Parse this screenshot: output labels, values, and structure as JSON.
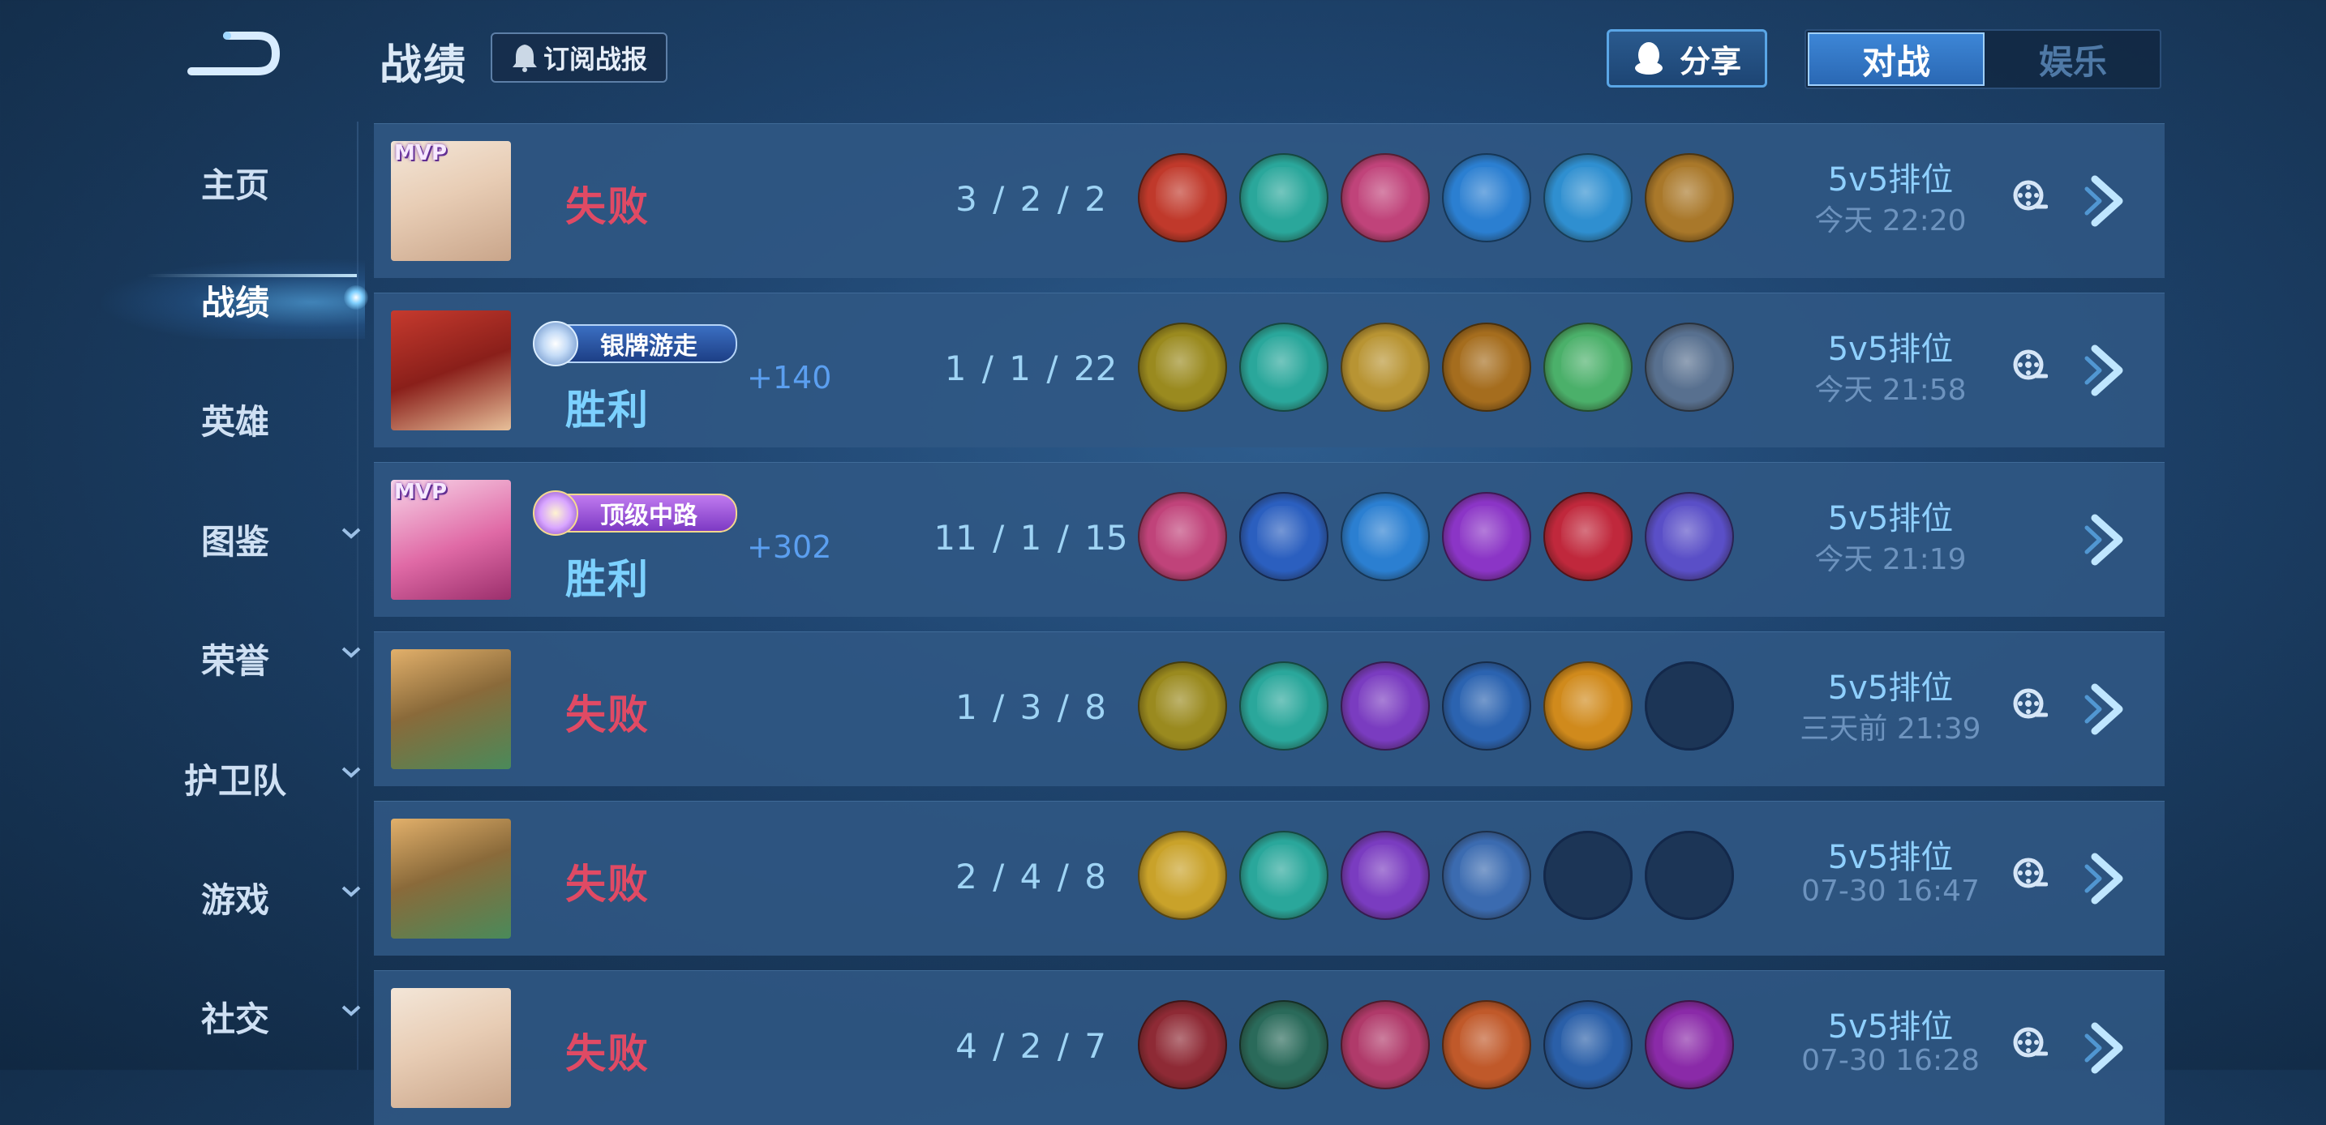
{
  "header": {
    "title": "战绩",
    "subscribe_label": "订阅战报",
    "share_label": "分享",
    "tabs": [
      {
        "label": "对战",
        "active": true
      },
      {
        "label": "娱乐",
        "active": false
      }
    ]
  },
  "sidebar": {
    "items": [
      {
        "label": "主页",
        "has_chevron": false,
        "active": false
      },
      {
        "label": "战绩",
        "has_chevron": false,
        "active": true
      },
      {
        "label": "英雄",
        "has_chevron": false,
        "active": false
      },
      {
        "label": "图鉴",
        "has_chevron": true,
        "active": false
      },
      {
        "label": "荣誉",
        "has_chevron": true,
        "active": false
      },
      {
        "label": "护卫队",
        "has_chevron": true,
        "active": false
      },
      {
        "label": "游戏",
        "has_chevron": true,
        "active": false
      },
      {
        "label": "社交",
        "has_chevron": true,
        "active": false
      }
    ]
  },
  "matches": [
    {
      "mvp": "MVP",
      "badge": "",
      "result": "失败",
      "outcome": "lose",
      "score": "",
      "kda": "3 / 2 / 2",
      "mode": "5v5排位",
      "time": "今天 22:20",
      "replay": true,
      "items": [
        "#c0392b",
        "#2aa79b",
        "#c0437a",
        "#2b7fd1",
        "#2f8fd0",
        "#a9782a"
      ]
    },
    {
      "mvp": "",
      "badge": "银牌游走",
      "badge_style": "silver",
      "result": "胜利",
      "outcome": "win",
      "score": "+140",
      "kda": "1 / 1 / 22",
      "mode": "5v5排位",
      "time": "今天 21:58",
      "replay": true,
      "items": [
        "#9a8a1f",
        "#2aa79b",
        "#b89433",
        "#a56d1e",
        "#4bb06a",
        "#58708f"
      ]
    },
    {
      "mvp": "MVP",
      "badge": "顶级中路",
      "badge_style": "purple",
      "result": "胜利",
      "outcome": "win",
      "score": "+302",
      "kda": "11 / 1 / 15",
      "mode": "5v5排位",
      "time": "今天 21:19",
      "replay": false,
      "items": [
        "#c0437a",
        "#2b5fbf",
        "#2b7fd1",
        "#8b35c6",
        "#c0283c",
        "#5a4fc7"
      ]
    },
    {
      "mvp": "",
      "badge": "",
      "result": "失败",
      "outcome": "lose",
      "score": "",
      "kda": "1 / 3 / 8",
      "mode": "5v5排位",
      "time": "三天前 21:39",
      "replay": true,
      "items": [
        "#9a8a1f",
        "#2aa79b",
        "#7a3cc0",
        "#2b63b0",
        "#d08a1c",
        ""
      ]
    },
    {
      "mvp": "",
      "badge": "",
      "result": "失败",
      "outcome": "lose",
      "score": "",
      "kda": "2 / 4 / 8",
      "mode": "5v5排位",
      "time": "07-30  16:47",
      "replay": true,
      "items": [
        "#c9a22a",
        "#2aa79b",
        "#7a3cc0",
        "#3b6bb0",
        "",
        ""
      ]
    },
    {
      "mvp": "",
      "badge": "",
      "result": "失败",
      "outcome": "lose",
      "score": "",
      "kda": "4 / 2 / 7",
      "mode": "5v5排位",
      "time": "07-30  16:28",
      "replay": true,
      "items": [
        "#8e2a35",
        "#2a6a5a",
        "#b03a6a",
        "#c0592a",
        "#2a5fa8",
        "#8a2aa8"
      ]
    }
  ],
  "colors": {
    "lose": "#e04a64",
    "win": "#7cd1ff",
    "accent": "#3d86d6"
  }
}
